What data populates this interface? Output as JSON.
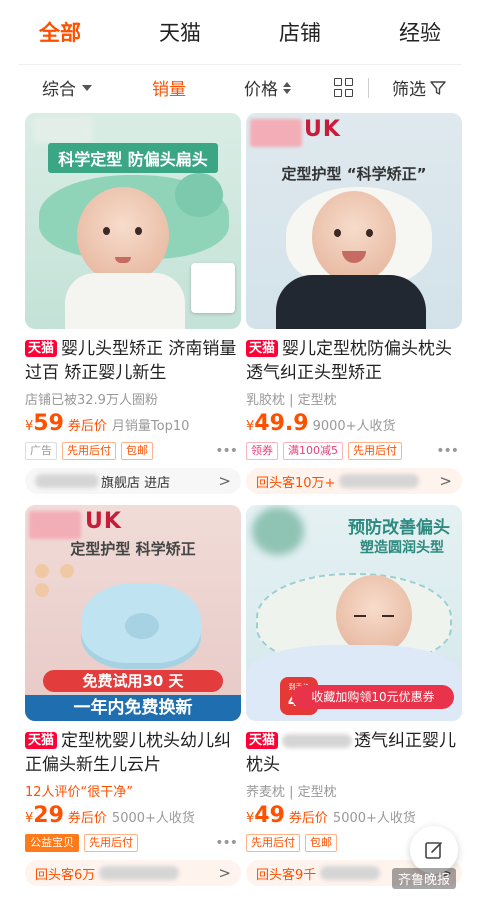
{
  "top_tabs": [
    "全部",
    "天猫",
    "店铺",
    "经验"
  ],
  "filter": {
    "sort_default": "综合",
    "sort_sales": "销量",
    "sort_price": "价格",
    "filter": "筛选"
  },
  "products": [
    {
      "image_text": "科学定型 防偏头扁头",
      "badge": "天猫",
      "title": "婴儿头型矫正 济南销量过百 矫正婴儿新生",
      "subtitle": "店铺已被32.9万人圈粉",
      "currency": "¥",
      "price": "59",
      "price_label": "券后价",
      "sales": "月销量Top10",
      "tags": [
        "广告",
        "先用后付",
        "包邮"
      ],
      "footer": "旗舰店 进店",
      "footer_arrow": ">"
    },
    {
      "image_logo": "UK",
      "image_text": "定型护型 “科学矫正”",
      "badge": "天猫",
      "title": "婴儿定型枕防偏头枕头透气纠正头型矫正",
      "subtitle": "乳胶枕 | 定型枕",
      "currency": "¥",
      "price": "49.9",
      "sales": "9000+人收货",
      "tags": [
        "领券",
        "满100减5",
        "先用后付"
      ],
      "footer": "回头客10万+",
      "footer_arrow": ">"
    },
    {
      "image_logo": "UK",
      "image_text": "定型护型  科学矫正",
      "image_bar_1": "免费试用30 天",
      "image_bar_2": "一年内免费换新",
      "badge": "天猫",
      "title": "定型枕婴儿枕头幼儿纠正偏头新生儿云片",
      "subtitle": "12人评价“很干净”",
      "currency": "¥",
      "price": "29",
      "price_label": "券后价",
      "sales": "5000+人收货",
      "tags": [
        "公益宝贝",
        "先用后付"
      ],
      "footer": "回头客6万",
      "footer_arrow": ">"
    },
    {
      "image_text_1": "预防改善偏头",
      "image_text_2": "塑造圆润头型",
      "image_price_tag": "49",
      "image_price_note": "到手价",
      "image_coupon": "收藏加购领10元优惠券",
      "badge": "天猫",
      "title": "透气纠正婴儿枕头",
      "subtitle": "荞麦枕 | 定型枕",
      "currency": "¥",
      "price": "49",
      "price_label": "券后价",
      "sales": "5000+人收货",
      "tags": [
        "先用后付",
        "包邮"
      ],
      "footer": "回头客9千",
      "footer_arrow": ">"
    }
  ],
  "watermark": "齐鲁晚报",
  "colors": {
    "accent": "#ff5000",
    "tmall": "#ff0036"
  },
  "icons": {
    "more": "more-dots-icon",
    "edit": "edit-icon"
  }
}
